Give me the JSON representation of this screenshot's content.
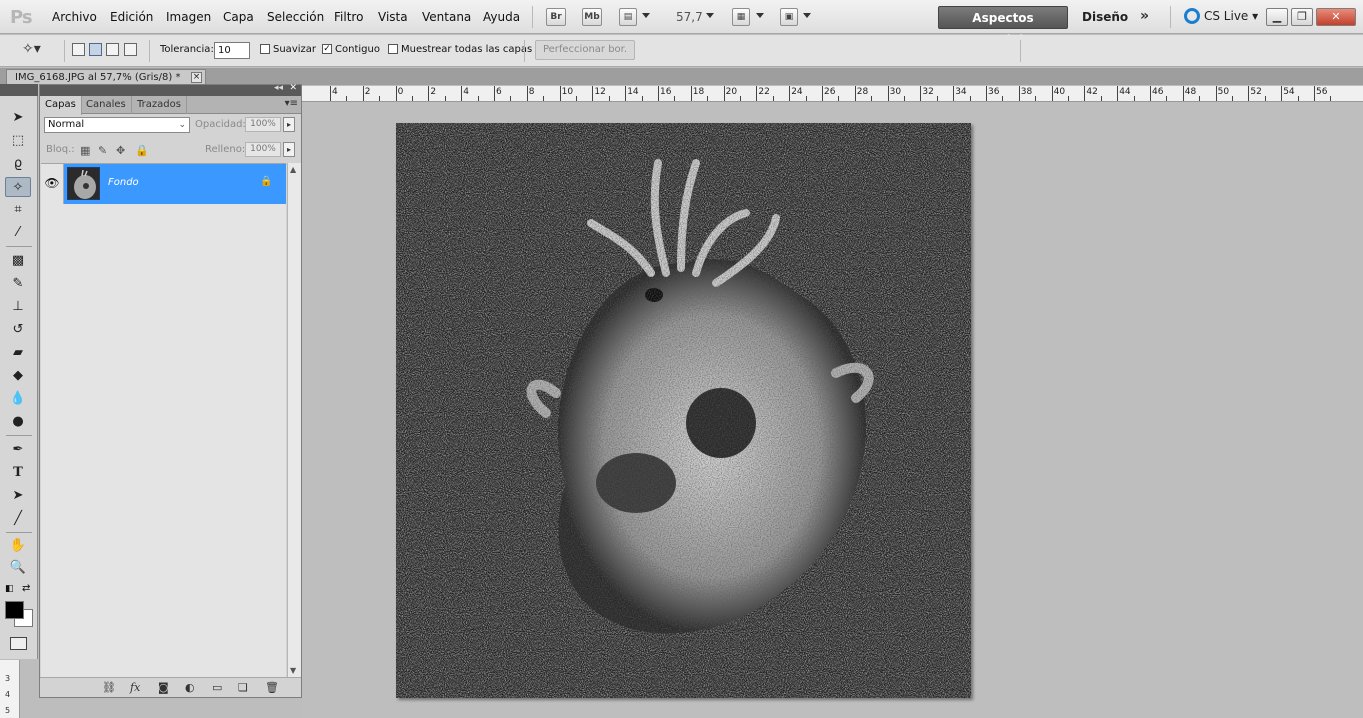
{
  "app": {
    "logo": "Ps"
  },
  "menu": {
    "items": [
      "Archivo",
      "Edición",
      "Imagen",
      "Capa",
      "Selección",
      "Filtro",
      "Vista",
      "Ventana",
      "Ayuda"
    ],
    "bridge_label": "Br",
    "minibridge_label": "Mb",
    "zoom": "57,7"
  },
  "workspace": {
    "active": "Aspectos esenciales",
    "design": "Diseño",
    "more": "»",
    "cslive": "CS Live"
  },
  "options": {
    "tolerance_label": "Tolerancia:",
    "tolerance_value": "10",
    "antialias_label": "Suavizar",
    "antialias_checked": false,
    "contiguous_label": "Contiguo",
    "contiguous_checked": true,
    "sample_all_label": "Muestrear todas las capas",
    "sample_all_checked": false,
    "refine_label": "Perfeccionar bor."
  },
  "document": {
    "tab_title": "IMG_6168.JPG al 57,7% (Gris/8) *",
    "close": "×"
  },
  "ruler": {
    "labels": [
      "4",
      "2",
      "0",
      "2",
      "4",
      "6",
      "8",
      "10",
      "12",
      "14",
      "16",
      "18",
      "20",
      "22",
      "24",
      "26",
      "28",
      "30",
      "32",
      "34",
      "36",
      "38",
      "40",
      "42",
      "44",
      "46",
      "48",
      "50",
      "52",
      "54",
      "56"
    ],
    "side_labels": [
      "3",
      "4",
      "5"
    ]
  },
  "layers_panel": {
    "tabs": [
      "Capas",
      "Canales",
      "Trazados"
    ],
    "active_tab": "Capas",
    "blend_mode": "Normal",
    "opacity_label": "Opacidad:",
    "opacity_value": "100%",
    "lock_label": "Bloq.:",
    "fill_label": "Relleno:",
    "fill_value": "100%",
    "layers": [
      {
        "name": "Fondo",
        "visible": true,
        "locked": true,
        "selected": true
      }
    ]
  },
  "colors": {
    "selection_blue": "#3a98ff",
    "workspace_active": "#5f5f5f",
    "foreground": "#000000",
    "background": "#ffffff"
  },
  "icons": [
    "move-icon",
    "marquee-icon",
    "lasso-icon",
    "quick-select-icon",
    "crop-icon",
    "eyedropper-icon",
    "healing-icon",
    "brush-icon",
    "stamp-icon",
    "history-brush-icon",
    "eraser-icon",
    "bucket-icon",
    "blur-icon",
    "dodge-icon",
    "pen-icon",
    "type-icon",
    "path-select-icon",
    "line-icon",
    "hand-icon",
    "zoom-icon"
  ]
}
